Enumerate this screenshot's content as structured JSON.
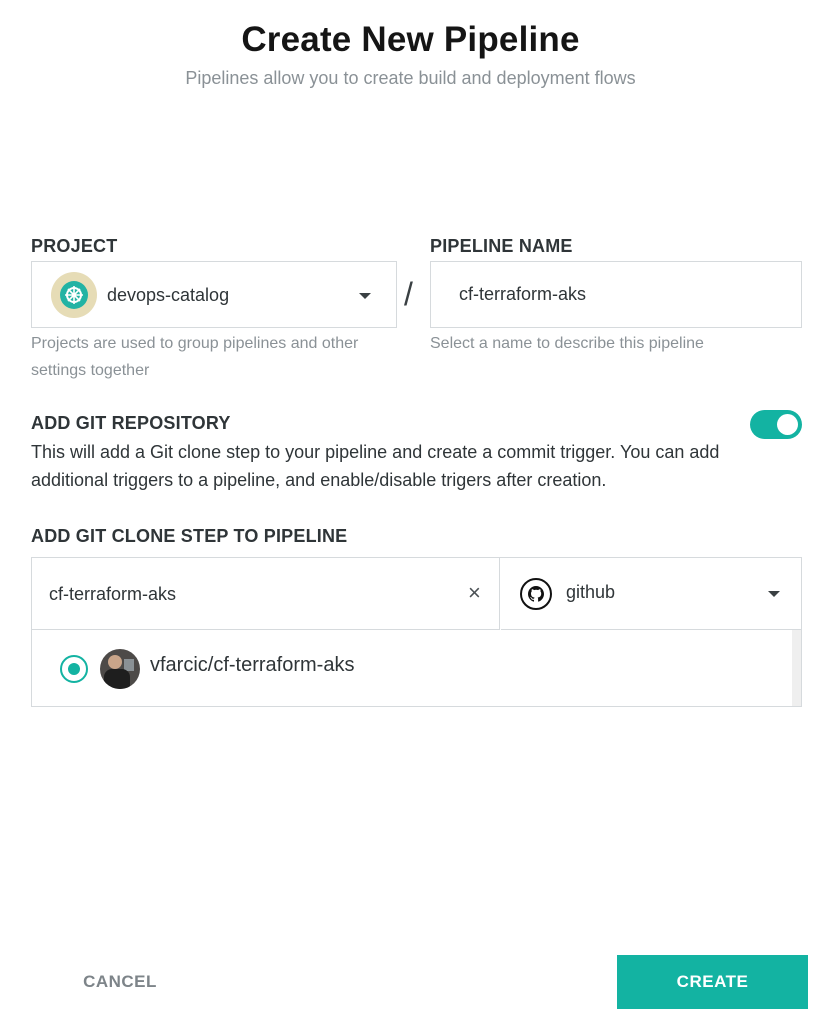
{
  "header": {
    "title": "Create New Pipeline",
    "subtitle": "Pipelines allow you to create build and deployment flows"
  },
  "project": {
    "label": "PROJECT",
    "value": "devops-catalog",
    "helper_line1": "Projects are used to group pipelines and other",
    "helper_line2": "settings together",
    "icon": "kubernetes-icon"
  },
  "separator": "/",
  "pipeline_name": {
    "label": "PIPELINE NAME",
    "value": "cf-terraform-aks",
    "helper": "Select a name to describe this pipeline"
  },
  "git_repo": {
    "label": "ADD GIT REPOSITORY",
    "enabled": true,
    "description_line1": "This will add a Git clone step to your pipeline and create a commit trigger. You can add",
    "description_line2": "additional triggers to a pipeline, and enable/disable trigers after creation."
  },
  "git_clone": {
    "label": "ADD GIT CLONE STEP TO PIPELINE",
    "search_value": "cf-terraform-aks",
    "clear_symbol": "×",
    "provider": "github",
    "repos": [
      {
        "name": "vfarcic/cf-terraform-aks",
        "selected": true
      }
    ]
  },
  "actions": {
    "cancel": "CANCEL",
    "create": "CREATE"
  },
  "colors": {
    "accent": "#13b3a2",
    "border": "#d6dadd",
    "muted_text": "#8a9196"
  }
}
